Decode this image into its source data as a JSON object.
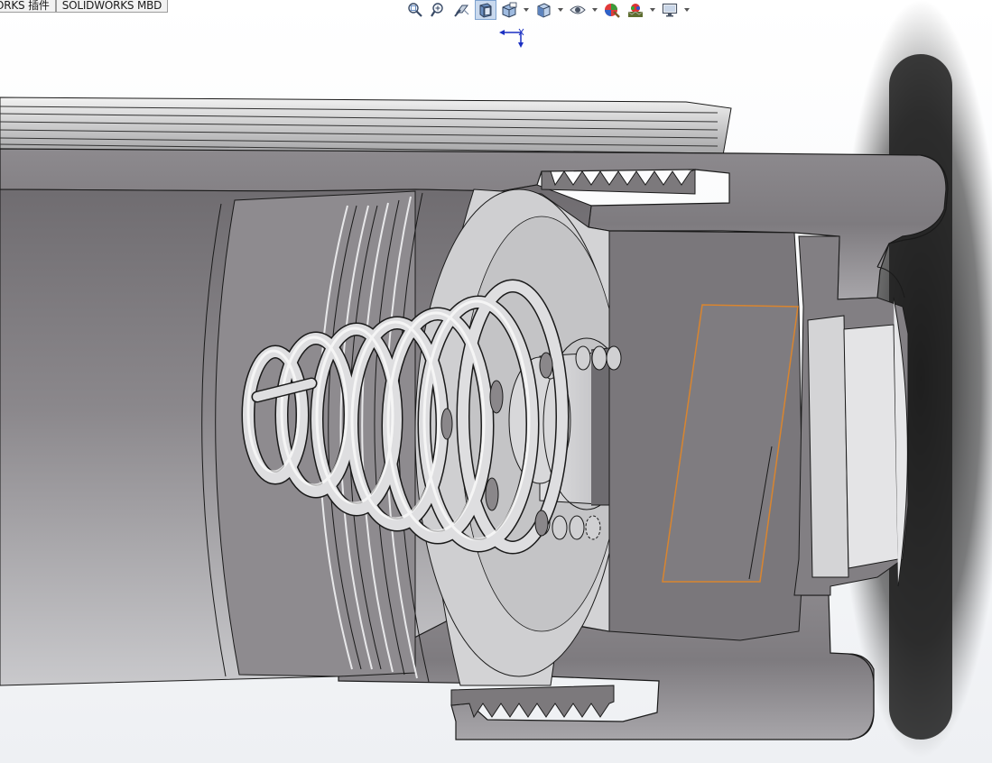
{
  "command_manager": {
    "tabs": [
      {
        "label": "ORKS 插件"
      },
      {
        "label": "SOLIDWORKS MBD"
      }
    ]
  },
  "heads_up_toolbar": {
    "buttons": [
      {
        "icon": "zoom-to-fit-icon"
      },
      {
        "icon": "zoom-to-area-icon"
      },
      {
        "icon": "previous-view-icon"
      },
      {
        "icon": "section-view-icon",
        "active": true
      },
      {
        "icon": "dynamic-annotation-views-icon"
      },
      {
        "icon": "view-orientation-icon"
      },
      {
        "icon": "display-style-icon"
      },
      {
        "icon": "hide-show-items-icon"
      },
      {
        "icon": "edit-appearance-icon"
      },
      {
        "icon": "apply-scene-icon"
      },
      {
        "icon": "view-settings-icon"
      }
    ]
  },
  "graphics": {
    "model": "section-view-spring-assembly",
    "colors": {
      "body": "#7c797c",
      "body_dark": "#656266",
      "section_face": "#8a878a",
      "light_face": "#d4d4d6",
      "spring": "#dcdcde",
      "outline": "#1a1a1a",
      "selection": "#d9852f",
      "triad": "#1a2fc2"
    }
  }
}
